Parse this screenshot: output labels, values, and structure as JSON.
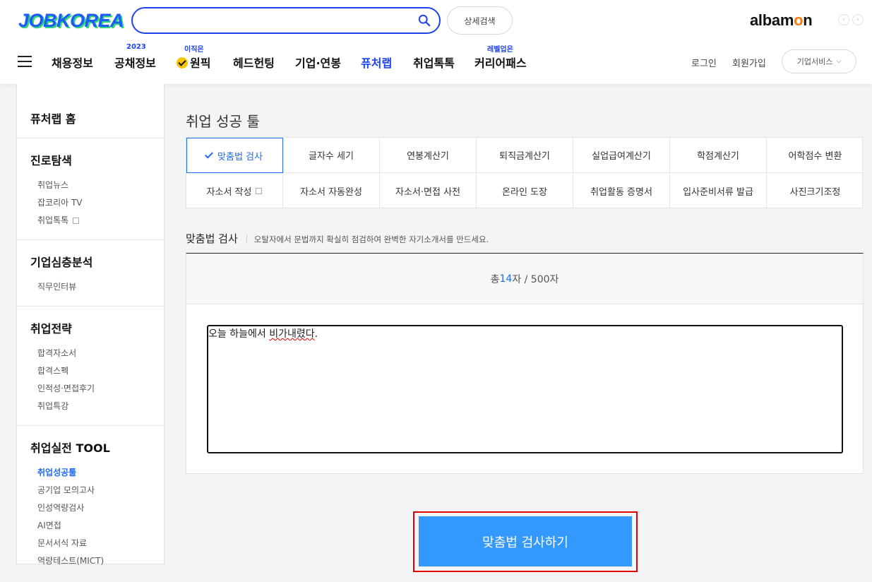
{
  "header": {
    "logo": "JOBKOREA",
    "search": {
      "value": "",
      "placeholder": ""
    },
    "detail_search": "상세검색",
    "partner_logo": "albamon",
    "nav": [
      {
        "label": "채용정보",
        "sup": ""
      },
      {
        "label": "공채정보",
        "sup": "2023"
      },
      {
        "label": "원픽",
        "sup": "이직은"
      },
      {
        "label": "헤드헌팅",
        "sup": ""
      },
      {
        "label": "기업·연봉",
        "sup": ""
      },
      {
        "label": "퓨처랩",
        "sup": ""
      },
      {
        "label": "취업톡톡",
        "sup": ""
      },
      {
        "label": "커리어패스",
        "sup": "레벨업은"
      }
    ],
    "login": "로그인",
    "join": "회원가입",
    "biz_service": "기업서비스",
    "accent": "#1d43f0"
  },
  "sidebar": {
    "home": "퓨처랩 홈",
    "sections": [
      {
        "title": "진로탐색",
        "items": [
          "취업뉴스",
          "잡코리아 TV",
          "취업톡톡"
        ]
      },
      {
        "title": "기업심층분석",
        "items": [
          "직무인터뷰"
        ]
      },
      {
        "title": "취업전략",
        "items": [
          "합격자소서",
          "합격스펙",
          "인적성·면접후기",
          "취업특강"
        ]
      },
      {
        "title": "취업실전 TOOL",
        "items": [
          "취업성공툴",
          "공기업 모의고사",
          "인성역량검사",
          "AI면접",
          "문서서식 자료",
          "역량테스트(MICT)"
        ]
      }
    ]
  },
  "main": {
    "title": "취업 성공 툴",
    "tools": [
      "맞춤법 검사",
      "글자수 세기",
      "연봉계산기",
      "퇴직금계산기",
      "실업급여계산기",
      "학점계산기",
      "어학점수 변환",
      "자소서 작성",
      "자소서 자동완성",
      "자소서·면접 사전",
      "온라인 도장",
      "취업활동 증명서",
      "입사준비서류 발급",
      "사진크기조정"
    ],
    "section_title": "맞춤법 검사",
    "section_desc": "오탈자에서 문법까지 확실히 점검하여 완벽한 자기소개서를 만드세요.",
    "count_prefix": "총 ",
    "count_value": "14",
    "count_suffix": "자 / 500자",
    "text_plain": "오늘 하늘에서 ",
    "text_error": "비가내렸다",
    "text_end": ".",
    "submit": "맞춤법 검사하기",
    "button_color": "#3399ff",
    "highlight_color": "#e10000"
  }
}
